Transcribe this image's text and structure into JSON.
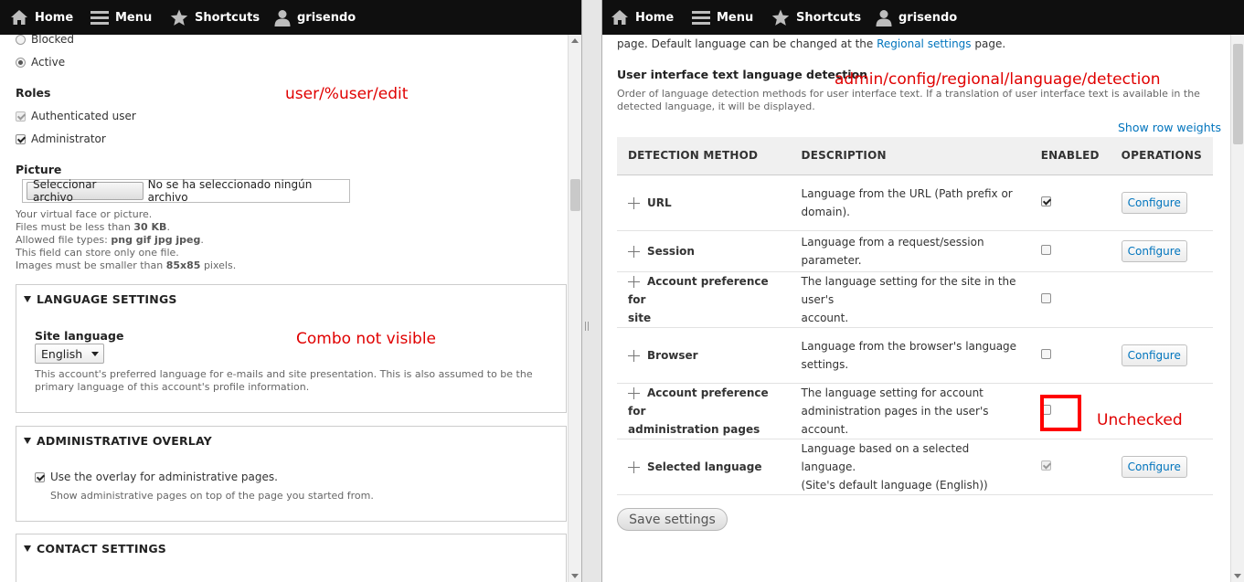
{
  "toolbar": {
    "home": "Home",
    "menu": "Menu",
    "shortcuts": "Shortcuts",
    "user": "grisendo"
  },
  "left": {
    "status_blocked": "Blocked",
    "status_active": "Active",
    "roles_label": "Roles",
    "role_authenticated": "Authenticated user",
    "role_admin": "Administrator",
    "picture_label": "Picture",
    "file_button": "Seleccionar archivo",
    "file_status": "No se ha seleccionado ningún archivo",
    "picture_desc": {
      "line1": "Your virtual face or picture.",
      "line2_pre": "Files must be less than ",
      "line2_b": "30 KB",
      "line2_post": ".",
      "line3_pre": "Allowed file types: ",
      "line3_b": "png gif jpg jpeg",
      "line3_post": ".",
      "line4": "This field can store only one file.",
      "line5_pre": "Images must be smaller than ",
      "line5_b": "85x85",
      "line5_post": " pixels."
    },
    "annotation_path": "user/%user/edit",
    "lang_settings_title": "LANGUAGE SETTINGS",
    "site_language_label": "Site language",
    "site_language_value": "English",
    "annotation_combo": "Combo not visible",
    "site_language_desc_1": "This account's preferred language for e-mails and site presentation. This is also assumed to be the",
    "site_language_desc_2": "primary language of this account's profile information.",
    "overlay_title": "ADMINISTRATIVE OVERLAY",
    "overlay_checkbox": "Use the overlay for administrative pages.",
    "overlay_desc": "Show administrative pages on top of the page you started from.",
    "contact_title": "CONTACT SETTINGS"
  },
  "right": {
    "intro_pre": "page. Default language can be changed at the ",
    "intro_link": "Regional settings",
    "intro_post": " page.",
    "section_title": "User interface text language detection",
    "annotation_path": "admin/config/regional/language/detection",
    "section_desc_1": "Order of language detection methods for user interface text. If a translation of user interface text is available in the",
    "section_desc_2": "detected language, it will be displayed.",
    "show_weights": "Show row weights",
    "headers": {
      "method": "DETECTION METHOD",
      "description": "DESCRIPTION",
      "enabled": "ENABLED",
      "operations": "OPERATIONS"
    },
    "rows": [
      {
        "name_1": "URL",
        "name_2": "",
        "desc_1": "Language from the URL (Path prefix or",
        "desc_2": "domain).",
        "op": "Configure"
      },
      {
        "name_1": "Session",
        "name_2": "",
        "desc_1": "Language from a request/session parameter.",
        "desc_2": "",
        "op": "Configure"
      },
      {
        "name_1": "Account preference for",
        "name_2": "site",
        "desc_1": "The language setting for the site in the user's",
        "desc_2": "account.",
        "op": ""
      },
      {
        "name_1": "Browser",
        "name_2": "",
        "desc_1": "Language from the browser's language",
        "desc_2": "settings.",
        "op": "Configure"
      },
      {
        "name_1": "Account preference for",
        "name_2": "administration pages",
        "desc_1": "The language setting for account",
        "desc_2": "administration pages in the user's account.",
        "op": ""
      },
      {
        "name_1": "Selected language",
        "name_2": "",
        "desc_1": "Language based on a selected language.",
        "desc_2": "(Site's default language (English))",
        "op": "Configure"
      }
    ],
    "annotation_unchecked": "Unchecked",
    "save_button": "Save settings"
  },
  "colors": {
    "toolbar": "#0f0f0f",
    "annotation": "#e00000",
    "link": "#0074bd"
  }
}
